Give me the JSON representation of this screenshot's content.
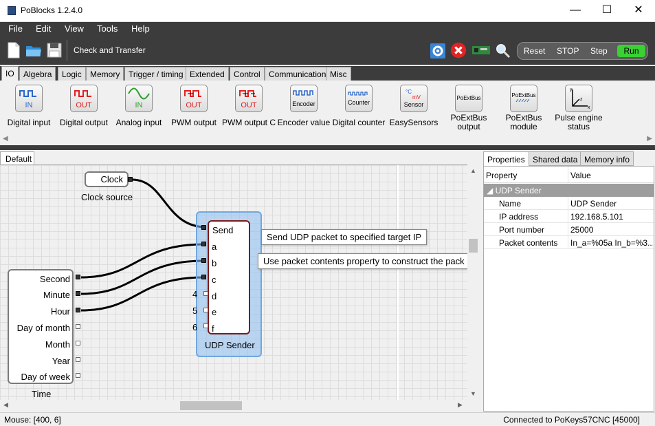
{
  "window": {
    "title": "PoBlocks 1.2.4.0",
    "minimize": "—",
    "maximize": "☐",
    "close": "✕"
  },
  "menu": [
    "File",
    "Edit",
    "View",
    "Tools",
    "Help"
  ],
  "toolbar": {
    "check_transfer": "Check and Transfer",
    "reset": "Reset",
    "stop": "STOP",
    "step": "Step",
    "run": "Run",
    "run_color": "#3bd033"
  },
  "categories": [
    "IO",
    "Algebra",
    "Logic",
    "Memory",
    "Trigger / timing",
    "Extended",
    "Control",
    "Communication",
    "Misc"
  ],
  "palette": [
    {
      "label": "Digital input",
      "glyph": "IN",
      "glyph_color": "#2a66c8"
    },
    {
      "label": "Digital output",
      "glyph": "OUT",
      "glyph_color": "#e02020"
    },
    {
      "label": "Analog input",
      "glyph": "IN",
      "glyph_color": "#2ca02c"
    },
    {
      "label": "PWM output",
      "glyph": "OUT",
      "glyph_color": "#e02020"
    },
    {
      "label": "PWM output C",
      "glyph": "OUT",
      "glyph_color": "#e02020"
    },
    {
      "label": "Encoder value",
      "glyph": "Encoder",
      "glyph_color": "#000000"
    },
    {
      "label": "Digital counter",
      "glyph": "Counter",
      "glyph_color": "#000000"
    },
    {
      "label": "EasySensors",
      "glyph": "Sensor",
      "glyph_color": "#000000"
    },
    {
      "label": "PoExtBus output",
      "glyph": "PoExtBus",
      "glyph_color": "#000000"
    },
    {
      "label": "PoExtBus module",
      "glyph": "PoExtBus",
      "glyph_color": "#000000"
    },
    {
      "label": "Pulse engine status",
      "glyph": "",
      "glyph_color": "#000000"
    }
  ],
  "document_tab": "Default",
  "canvas": {
    "clock_block": "Clock",
    "clock_caption": "Clock source",
    "time_outputs": [
      "Second",
      "Minute",
      "Hour",
      "Day of month",
      "Month",
      "Year",
      "Day of week"
    ],
    "time_caption": "Time",
    "udp_inputs": [
      "Send",
      "a",
      "b",
      "c",
      "d",
      "e",
      "f"
    ],
    "udp_input_numbers": [
      "4",
      "5",
      "6"
    ],
    "udp_caption": "UDP Sender",
    "tooltip1": "Send UDP packet to specified target IP",
    "tooltip2": "Use packet contents property to construct the pack"
  },
  "properties": {
    "tabs": [
      "Properties",
      "Shared data",
      "Memory info"
    ],
    "col_property": "Property",
    "col_value": "Value",
    "group": "UDP Sender",
    "rows": [
      {
        "name": "Name",
        "value": "UDP Sender"
      },
      {
        "name": "IP address",
        "value": "192.168.5.101"
      },
      {
        "name": "Port number",
        "value": "25000"
      },
      {
        "name": "Packet contents",
        "value": "In_a=%05a In_b=%3..."
      }
    ]
  },
  "status": {
    "mouse": "Mouse: [400, 6]",
    "connection": "Connected to PoKeys57CNC [45000]"
  }
}
